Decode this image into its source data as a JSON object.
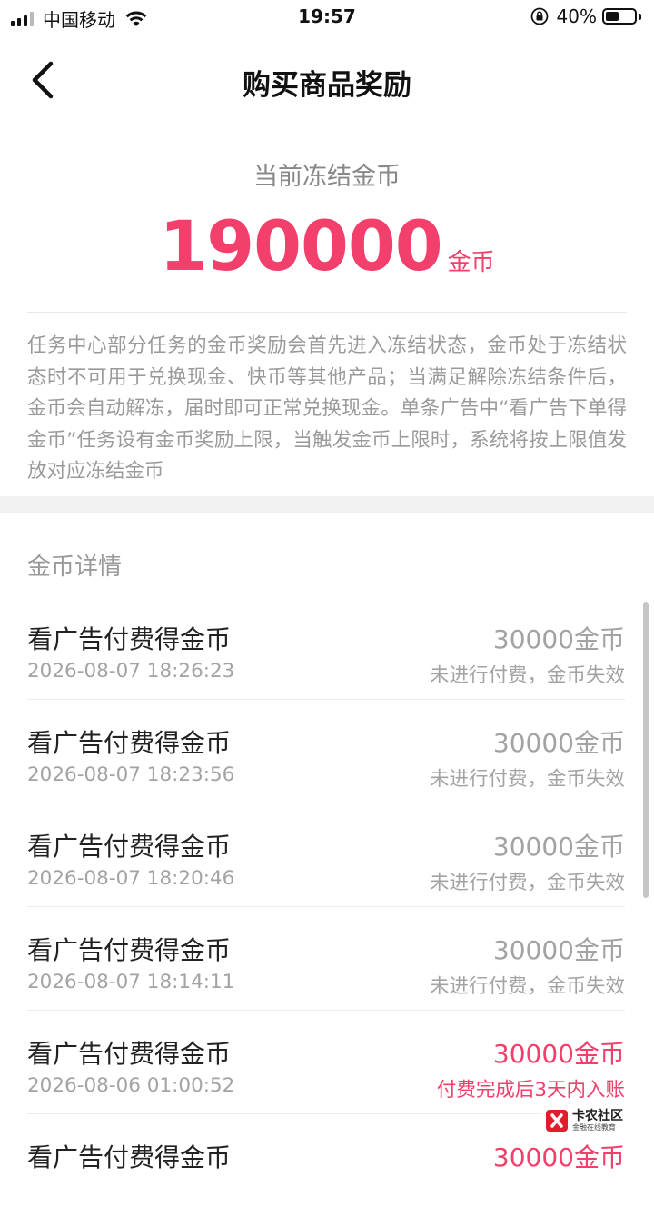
{
  "status_bar": {
    "carrier": "中国移动",
    "time": "19:57",
    "battery": "40%",
    "battery_level": 0.4,
    "icons": [
      "signal-icon",
      "wifi-icon",
      "rotation-lock-icon",
      "battery-icon"
    ]
  },
  "nav": {
    "title": "购买商品奖励",
    "back_icon": "chevron-left-icon"
  },
  "summary": {
    "label": "当前冻结金币",
    "amount": "190000",
    "unit": "金币",
    "description": "任务中心部分任务的金币奖励会首先进入冻结状态，金币处于冻结状态时不可用于兑换现金、快币等其他产品；当满足解除冻结条件后，金币会自动解冻，届时即可正常兑换现金。单条广告中“看广告下单得金币”任务设有金币奖励上限，当触发金币上限时，系统将按上限值发放对应冻结金币"
  },
  "section": {
    "title": "金币详情"
  },
  "records": [
    {
      "title": "看广告付费得金币",
      "time": "2026-08-07 18:26:23",
      "amount": "30000金币",
      "status": "未进行付费，金币失效"
    },
    {
      "title": "看广告付费得金币",
      "time": "2026-08-07 18:23:56",
      "amount": "30000金币",
      "status": "未进行付费，金币失效"
    },
    {
      "title": "看广告付费得金币",
      "time": "2026-08-07 18:20:46",
      "amount": "30000金币",
      "status": "未进行付费，金币失效"
    },
    {
      "title": "看广告付费得金币",
      "time": "2026-08-07 18:14:11",
      "amount": "30000金币",
      "status": "未进行付费，金币失效"
    },
    {
      "title": "看广告付费得金币",
      "time": "2026-08-06 01:00:52",
      "amount": "30000金币",
      "status": "付费完成后3天内入账"
    },
    {
      "title": "看广告付费得金币",
      "time": "",
      "amount": "30000金币",
      "status": ""
    }
  ],
  "watermark": {
    "title": "卡农社区",
    "subtitle": "金融在线教育"
  },
  "colors": {
    "accent": "#f23f6b",
    "muted_text": "#a3a3a3",
    "divider": "#ececec",
    "section_gap": "#f2f2f2"
  }
}
